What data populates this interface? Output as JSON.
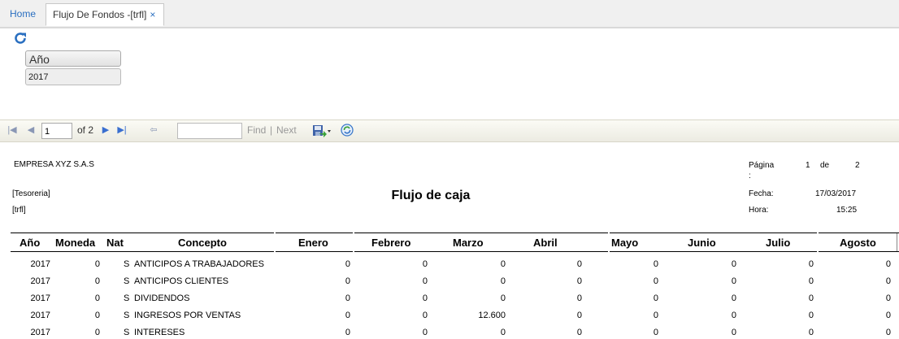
{
  "tabs": [
    {
      "label": "Home"
    },
    {
      "label": "Flujo De Fondos -[trfl]",
      "close": "×"
    }
  ],
  "params": {
    "label": "Año",
    "value": "2017"
  },
  "toolbar": {
    "page_value": "1",
    "page_total": "of 2",
    "find_label": "Find",
    "sep": "|",
    "next_label": "Next"
  },
  "report": {
    "company": "EMPRESA XYZ S.A.S",
    "dept": "[Tesoreria]",
    "code": "[trfl]",
    "title": "Flujo de caja",
    "page_label": "Página",
    "page_colon": ":",
    "page_num": "1",
    "page_de": "de",
    "page_total": "2",
    "fecha_label": "Fecha:",
    "fecha": "17/03/2017",
    "hora_label": "Hora:",
    "hora": "15:25",
    "columns": [
      "Año",
      "Moneda",
      "Nat",
      "Concepto",
      "Enero",
      "Febrero",
      "Marzo",
      "Abril",
      "Mayo",
      "Junio",
      "Julio",
      "Agosto"
    ],
    "rows": [
      [
        "2017",
        "0",
        "S",
        "ANTICIPOS A TRABAJADORES",
        "0",
        "0",
        "0",
        "0",
        "0",
        "0",
        "0",
        "0"
      ],
      [
        "2017",
        "0",
        "S",
        "ANTICIPOS CLIENTES",
        "0",
        "0",
        "0",
        "0",
        "0",
        "0",
        "0",
        "0"
      ],
      [
        "2017",
        "0",
        "S",
        "DIVIDENDOS",
        "0",
        "0",
        "0",
        "0",
        "0",
        "0",
        "0",
        "0"
      ],
      [
        "2017",
        "0",
        "S",
        "INGRESOS POR VENTAS",
        "0",
        "0",
        "12.600",
        "0",
        "0",
        "0",
        "0",
        "0"
      ],
      [
        "2017",
        "0",
        "S",
        "INTERESES",
        "0",
        "0",
        "0",
        "0",
        "0",
        "0",
        "0",
        "0"
      ]
    ]
  }
}
